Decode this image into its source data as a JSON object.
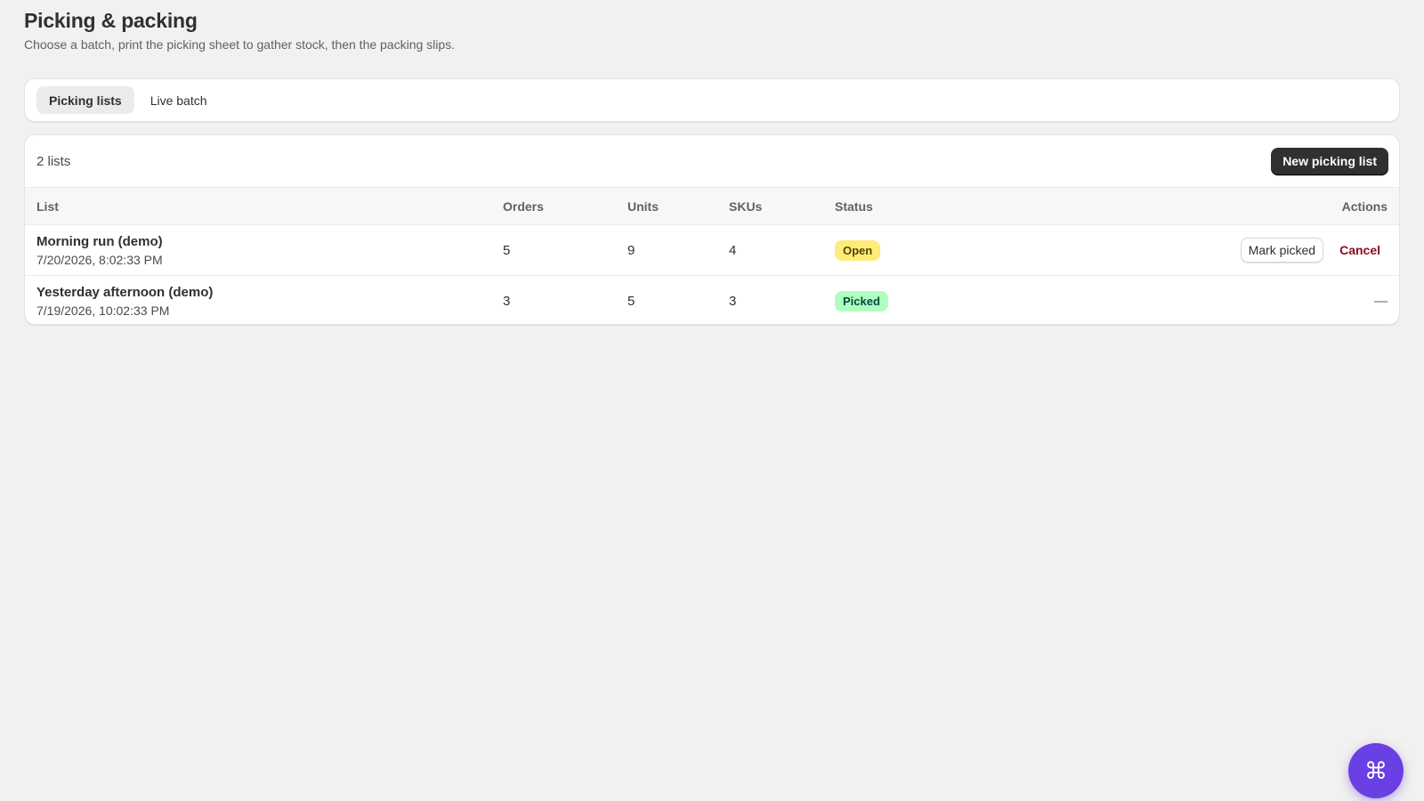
{
  "page": {
    "title": "Picking & packing",
    "subtitle": "Choose a batch, print the picking sheet to gather stock, then the packing slips."
  },
  "tabs": [
    {
      "label": "Picking lists",
      "active": true
    },
    {
      "label": "Live batch",
      "active": false
    }
  ],
  "list_card": {
    "count_label": "2 lists",
    "new_button_label": "New picking list"
  },
  "table": {
    "headers": {
      "list": "List",
      "orders": "Orders",
      "units": "Units",
      "skus": "SKUs",
      "status": "Status",
      "actions": "Actions"
    },
    "rows": [
      {
        "name": "Morning run (demo)",
        "date": "7/20/2026, 8:02:33 PM",
        "orders": "5",
        "units": "9",
        "skus": "4",
        "status": "Open",
        "mark_picked_label": "Mark picked",
        "cancel_label": "Cancel"
      },
      {
        "name": "Yesterday afternoon (demo)",
        "date": "7/19/2026, 10:02:33 PM",
        "orders": "3",
        "units": "5",
        "skus": "3",
        "status": "Picked",
        "actions_placeholder": "—"
      }
    ]
  },
  "fab": {
    "icon": "command-icon",
    "glyph": "⌘"
  },
  "colors": {
    "primary_button": "#303030",
    "badge_open": "#ffeb78",
    "badge_picked": "#affebf",
    "danger": "#8e0b21",
    "fab": "#6a3fe3"
  }
}
